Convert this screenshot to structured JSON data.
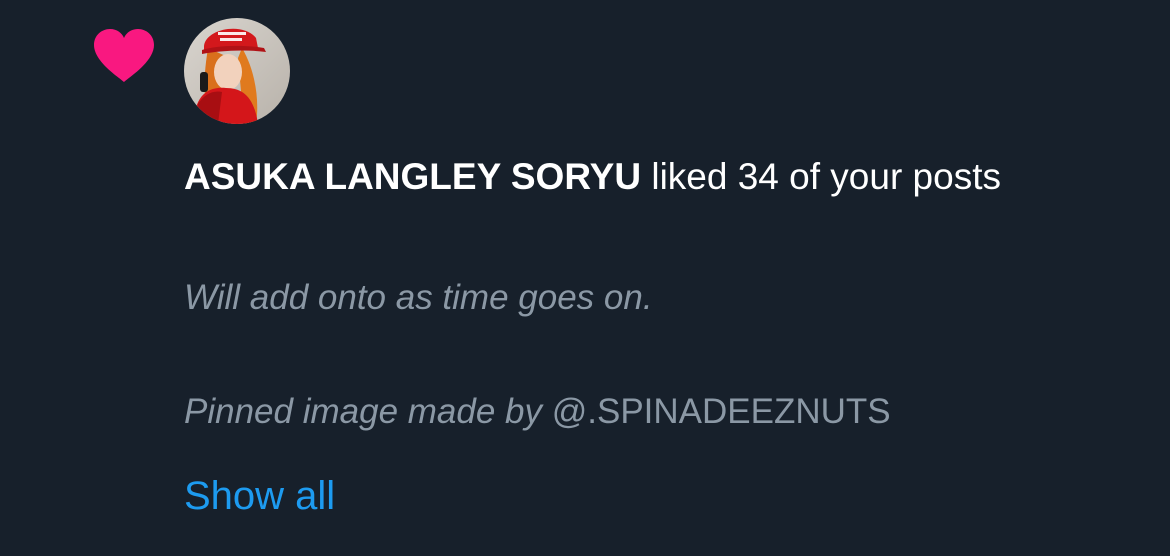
{
  "notification": {
    "type_icon": "heart-icon",
    "accent_color": "#f91880",
    "link_color": "#1d9bf0",
    "background_color": "#17202b",
    "user": {
      "display_name": "ASUKA LANGLEY SORYU",
      "avatar": "avatar-photo"
    },
    "action_text": " liked 34 of your posts",
    "bio": {
      "line1": "Will add onto as time goes on.",
      "line2_italic": "Pinned image made by ",
      "line2_handle": "@.SPINADEEZNUTS"
    },
    "show_all_label": "Show all"
  }
}
